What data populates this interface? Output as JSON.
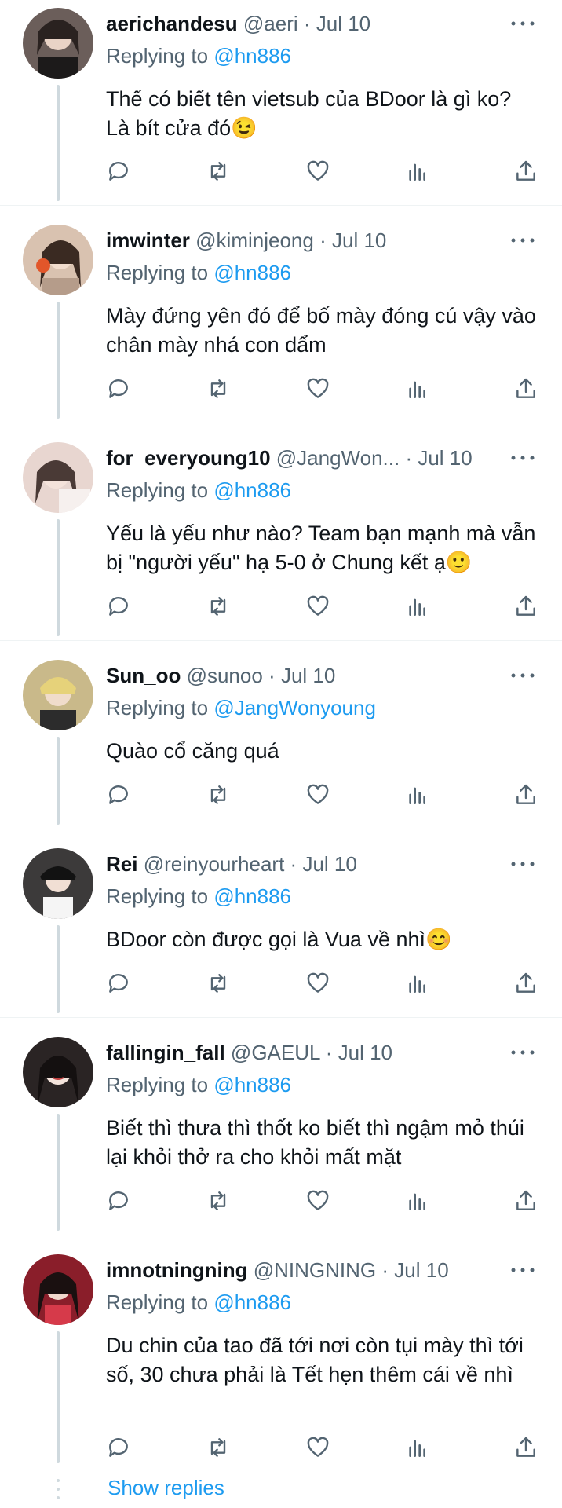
{
  "tweets": [
    {
      "name": "aerichandesu",
      "handle": "@aeri",
      "time": "Jul 10",
      "replying_label": "Replying to",
      "replying_to": "@hn886",
      "text": "Thế có biết tên vietsub của BDoor là gì ko? Là bít cửa đó😉",
      "avatar_bg": "#6b5e5a"
    },
    {
      "name": "imwinter",
      "handle": "@kiminjeong",
      "time": "Jul 10",
      "replying_label": "Replying to",
      "replying_to": "@hn886",
      "text": "Mày đứng yên đó để bố mày đóng cú vậy vào chân mày nhá con dẩm",
      "avatar_bg": "#d9c2b0"
    },
    {
      "name": "for_everyoung10",
      "handle": "@JangWon...",
      "time": "Jul 10",
      "replying_label": "Replying to",
      "replying_to": "@hn886",
      "text": "Yếu là yếu như nào? Team bạn mạnh mà vẫn bị \"người yếu\" hạ 5-0 ở Chung kết ạ🙂",
      "avatar_bg": "#e8d6d0"
    },
    {
      "name": "Sun_oo",
      "handle": "@sunoo",
      "time": "Jul 10",
      "replying_label": "Replying to",
      "replying_to": "@JangWonyoung",
      "text": "Quào cổ căng quá",
      "avatar_bg": "#c9b98a"
    },
    {
      "name": "Rei",
      "handle": "@reinyourheart",
      "time": "Jul 10",
      "replying_label": "Replying to",
      "replying_to": "@hn886",
      "text": "BDoor còn được gọi là Vua về nhì😊",
      "avatar_bg": "#3c3a3a"
    },
    {
      "name": "fallingin_fall",
      "handle": "@GAEUL",
      "time": "Jul 10",
      "replying_label": "Replying to",
      "replying_to": "@hn886",
      "text": "Biết thì thưa thì thốt ko biết thì ngậm mỏ thúi lại khỏi thở ra cho khỏi mất mặt",
      "avatar_bg": "#2a2424"
    },
    {
      "name": "imnotningning",
      "handle": "@NINGNING",
      "time": "Jul 10",
      "replying_label": "Replying to",
      "replying_to": "@hn886",
      "text": "Du chin của tao đã tới nơi còn tụi mày thì tới số, 30 chưa phải là Tết hẹn thêm cái về nhì",
      "avatar_bg": "#8a1e2a"
    }
  ],
  "show_replies": "Show replies",
  "icons": {
    "reply": "reply-icon",
    "retweet": "retweet-icon",
    "like": "like-icon",
    "views": "views-icon",
    "share": "share-icon",
    "more": "more-icon"
  }
}
